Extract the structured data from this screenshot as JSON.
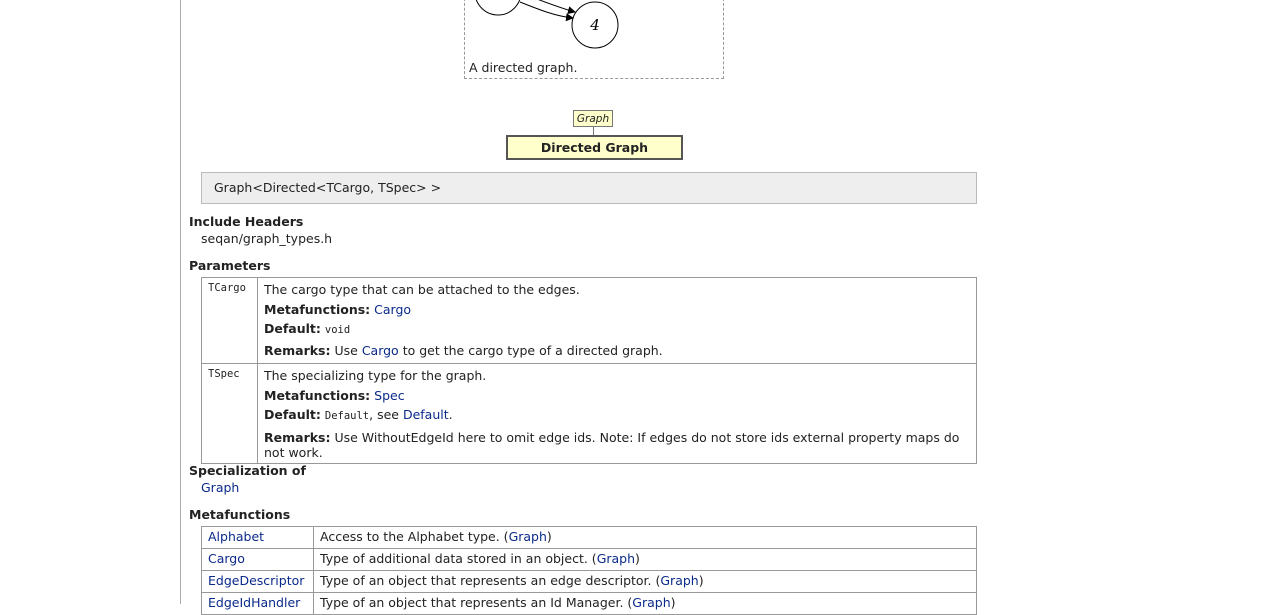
{
  "figure": {
    "node_label": "4",
    "caption": "A directed graph."
  },
  "hierarchy": {
    "parent_badge": "Graph",
    "class_name": "Directed Graph"
  },
  "signature": "Graph<Directed<TCargo, TSpec> >",
  "include_headers": {
    "title": "Include Headers",
    "value": "seqan/graph_types.h"
  },
  "parameters": {
    "title": "Parameters",
    "items": [
      {
        "name": "TCargo",
        "description": "The cargo type that can be attached to the edges.",
        "metafunctions_label": "Metafunctions:",
        "metafunctions_link": "Cargo",
        "default_label": "Default:",
        "default_value": "void",
        "remarks_label": "Remarks:",
        "remarks_pre": "Use",
        "remarks_link": "Cargo",
        "remarks_post": "to get the cargo type of a directed graph."
      },
      {
        "name": "TSpec",
        "description": "The specializing type for the graph.",
        "metafunctions_label": "Metafunctions:",
        "metafunctions_link": "Spec",
        "default_label": "Default:",
        "default_value": "Default",
        "default_see": ", see",
        "default_link": "Default",
        "default_end": ".",
        "remarks_label": "Remarks:",
        "remarks_text": "Use WithoutEdgeId here to omit edge ids. Note: If edges do not store ids external property maps do not work."
      }
    ]
  },
  "specialization": {
    "title": "Specialization of",
    "link": "Graph"
  },
  "metafunctions": {
    "title": "Metafunctions",
    "rows": [
      {
        "name": "Alphabet",
        "desc": "Access to the Alphabet type. (",
        "link": "Graph",
        "end": ")"
      },
      {
        "name": "Cargo",
        "desc": "Type of additional data stored in an object. (",
        "link": "Graph",
        "end": ")"
      },
      {
        "name": "EdgeDescriptor",
        "desc": "Type of an object that represents an edge descriptor. (",
        "link": "Graph",
        "end": ")"
      },
      {
        "name": "EdgeIdHandler",
        "desc": "Type of an object that represents an Id Manager. (",
        "link": "Graph",
        "end": ")"
      }
    ]
  }
}
